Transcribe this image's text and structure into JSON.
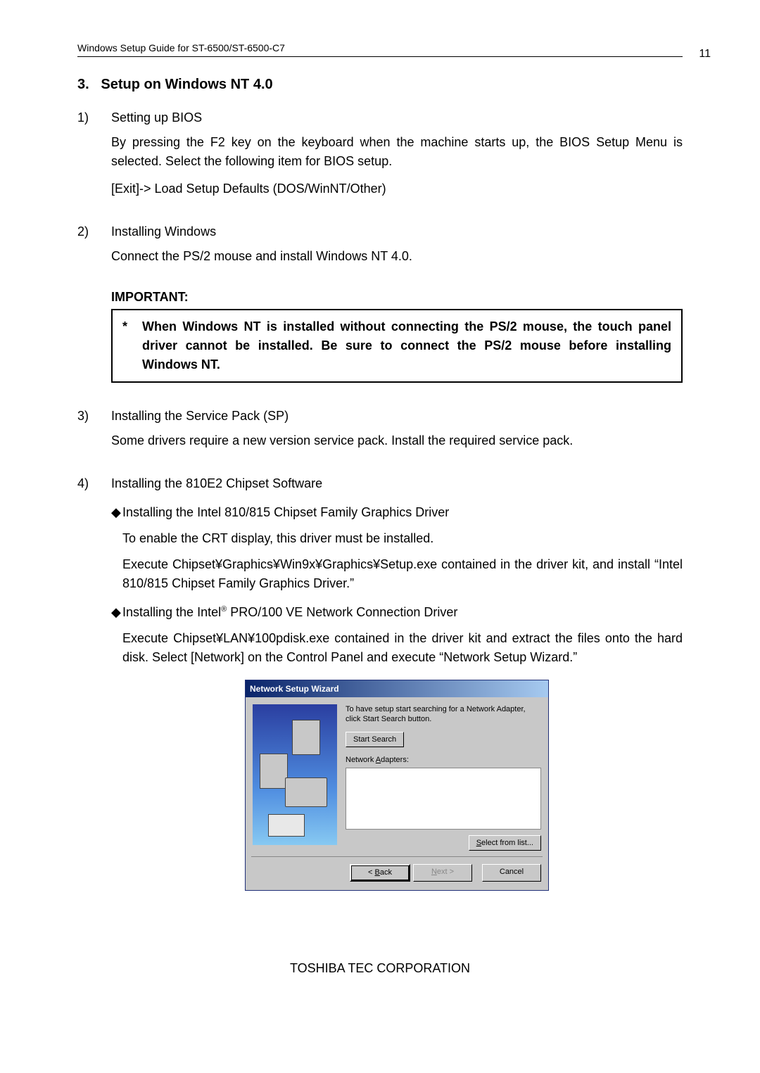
{
  "header": {
    "doc_title": "Windows Setup Guide for ST-6500/ST-6500-C7",
    "page_number": "11"
  },
  "section": {
    "number": "3.",
    "title": "Setup on Windows NT 4.0"
  },
  "items": [
    {
      "num": "1)",
      "title": "Setting up BIOS",
      "p1": "By pressing the F2 key on the keyboard when the machine starts up, the BIOS Setup Menu is selected.  Select the following item for BIOS setup.",
      "p2": "[Exit]-> Load Setup Defaults (DOS/WinNT/Other)"
    },
    {
      "num": "2)",
      "title": "Installing Windows",
      "p1": "Connect the PS/2 mouse and install Windows NT 4.0."
    },
    {
      "num": "3)",
      "title": "Installing the Service Pack (SP)",
      "p1": "Some drivers require a new version service pack.  Install the required service pack."
    },
    {
      "num": "4)",
      "title": "Installing the 810E2 Chipset Software"
    }
  ],
  "important": {
    "label": "IMPORTANT:",
    "star": "*",
    "text": "When Windows NT is installed without connecting the PS/2 mouse, the touch panel driver cannot be installed.  Be sure to connect the PS/2 mouse before installing Windows NT."
  },
  "bullets": [
    {
      "mark": "◆",
      "title": "Installing the Intel 810/815 Chipset Family Graphics Driver",
      "p1": "To enable the CRT display, this driver must be installed.",
      "p2": "Execute Chipset¥Graphics¥Win9x¥Graphics¥Setup.exe contained in the driver kit, and install “Intel 810/815 Chipset Family Graphics Driver.”"
    },
    {
      "mark": "◆",
      "title_pre": "Installing the Intel",
      "title_sup": "®",
      "title_post": " PRO/100 VE Network Connection Driver",
      "p1": "Execute Chipset¥LAN¥100pdisk.exe contained in the driver kit and extract the files onto the hard disk.  Select [Network] on the Control Panel and execute “Network Setup Wizard.”"
    }
  ],
  "wizard": {
    "title": "Network Setup Wizard",
    "instruction": "To have setup start searching for a Network Adapter, click Start Search button.",
    "start_search": "Start Search",
    "adapters_label_pre": "Network ",
    "adapters_label_u": "A",
    "adapters_label_post": "dapters:",
    "select_from_list_u": "S",
    "select_from_list_post": "elect from list...",
    "back_lt": "< ",
    "back_u": "B",
    "back_post": "ack",
    "next_u": "N",
    "next_post": "ext >",
    "cancel": "Cancel"
  },
  "footer": {
    "company": "TOSHIBA TEC CORPORATION"
  }
}
